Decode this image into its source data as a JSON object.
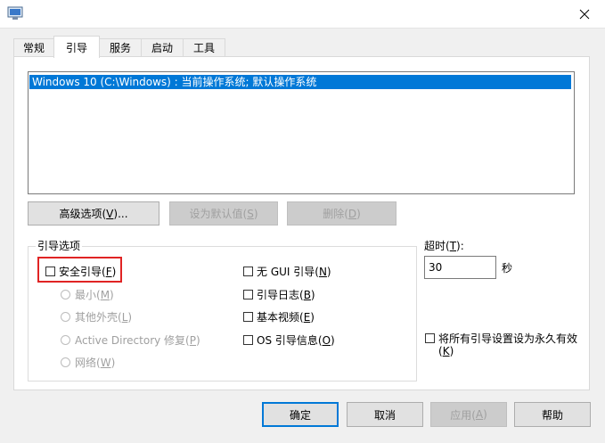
{
  "tabs": [
    {
      "label": "常规",
      "active": false
    },
    {
      "label": "引导",
      "active": true
    },
    {
      "label": "服务",
      "active": false
    },
    {
      "label": "启动",
      "active": false
    },
    {
      "label": "工具",
      "active": false
    }
  ],
  "os_list": {
    "items": [
      "Windows 10 (C:\\Windows) : 当前操作系统; 默认操作系统"
    ]
  },
  "os_buttons": {
    "advanced": {
      "pre": "高级选项(",
      "key": "V",
      "post": ")..."
    },
    "set_default": {
      "pre": "设为默认值(",
      "key": "S",
      "post": ")"
    },
    "delete": {
      "pre": "删除(",
      "key": "D",
      "post": ")"
    }
  },
  "boot_options": {
    "title": "引导选项",
    "safe_boot": {
      "pre": "安全引导(",
      "key": "F",
      "post": ")",
      "checked": false
    },
    "minimal": {
      "pre": "最小(",
      "key": "M",
      "post": ")"
    },
    "alt_shell": {
      "pre": "其他外壳(",
      "key": "L",
      "post": ")"
    },
    "ad_repair": {
      "pre": "Active Directory 修复(",
      "key": "P",
      "post": ")"
    },
    "network": {
      "pre": "网络(",
      "key": "W",
      "post": ")"
    },
    "no_gui": {
      "pre": "无 GUI 引导(",
      "key": "N",
      "post": ")",
      "checked": false
    },
    "boot_log": {
      "pre": "引导日志(",
      "key": "B",
      "post": ")",
      "checked": false
    },
    "base_video": {
      "pre": "基本视频(",
      "key": "E",
      "post": ")",
      "checked": false
    },
    "os_info": {
      "pre": "OS 引导信息(",
      "key": "O",
      "post": ")",
      "checked": false
    }
  },
  "timeout": {
    "pre": "超时(",
    "key": "T",
    "post": "):",
    "value": "30",
    "unit": "秒"
  },
  "permanent": {
    "line1": "将所有引导设置设为永久有效",
    "pre": "(",
    "key": "K",
    "post": ")",
    "checked": false
  },
  "footer": {
    "ok": "确定",
    "cancel": "取消",
    "apply": {
      "pre": "应用(",
      "key": "A",
      "post": ")"
    },
    "help": "帮助"
  },
  "colors": {
    "accent": "#0078d7",
    "highlight": "#e02424"
  }
}
